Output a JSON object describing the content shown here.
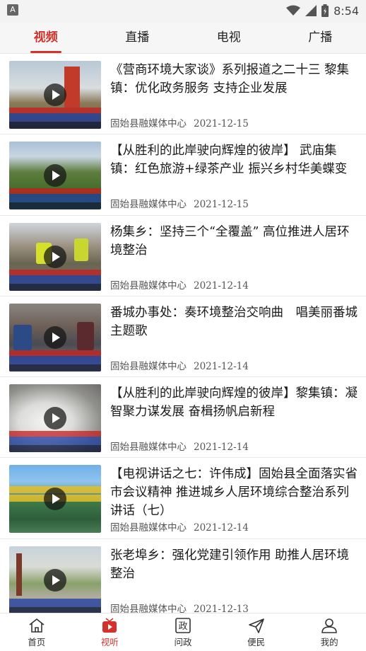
{
  "status_bar": {
    "app_icon": "A",
    "time": "8:54"
  },
  "top_tabs": [
    {
      "label": "视频",
      "active": true
    },
    {
      "label": "直播",
      "active": false
    },
    {
      "label": "电视",
      "active": false
    },
    {
      "label": "广播",
      "active": false
    }
  ],
  "news": [
    {
      "title": "《营商环境大家谈》系列报道之二十三 黎集镇：优化政务服务 支持企业发展",
      "source": "固始县融媒体中心",
      "date": "2021-12-15"
    },
    {
      "title": "【从胜利的此岸驶向辉煌的彼岸】 武庙集镇：红色旅游+绿茶产业 振兴乡村华美蝶变",
      "source": "固始县融媒体中心",
      "date": "2021-12-15"
    },
    {
      "title": "杨集乡：坚持三个“全覆盖” 高位推进人居环境整治",
      "source": "固始县融媒体中心",
      "date": "2021-12-14"
    },
    {
      "title": "番城办事处：奏环境整治交响曲　唱美丽番城主题歌",
      "source": "固始县融媒体中心",
      "date": "2021-12-14"
    },
    {
      "title": "【从胜利的此岸驶向辉煌的彼岸】黎集镇：凝智聚力谋发展 奋楫扬帆启新程",
      "source": "固始县融媒体中心",
      "date": "2021-12-14"
    },
    {
      "title": "【电视讲话之七：许伟成】固始县全面落实省市会议精神 推进城乡人居环境综合整治系列讲话（七）",
      "source": "固始县融媒体中心",
      "date": "2021-12-14"
    },
    {
      "title": "张老埠乡：强化党建引领作用 助推人居环境整治",
      "source": "固始县融媒体中心",
      "date": "2021-12-13"
    }
  ],
  "bottom_nav": [
    {
      "label": "首页",
      "icon": "home-icon",
      "active": false
    },
    {
      "label": "视听",
      "icon": "video-icon",
      "active": true
    },
    {
      "label": "问政",
      "icon": "politics-icon",
      "active": false
    },
    {
      "label": "便民",
      "icon": "send-icon",
      "active": false
    },
    {
      "label": "我的",
      "icon": "user-icon",
      "active": false
    }
  ],
  "colors": {
    "accent": "#d2312c",
    "text": "#1a1a1a",
    "meta": "#555555"
  }
}
